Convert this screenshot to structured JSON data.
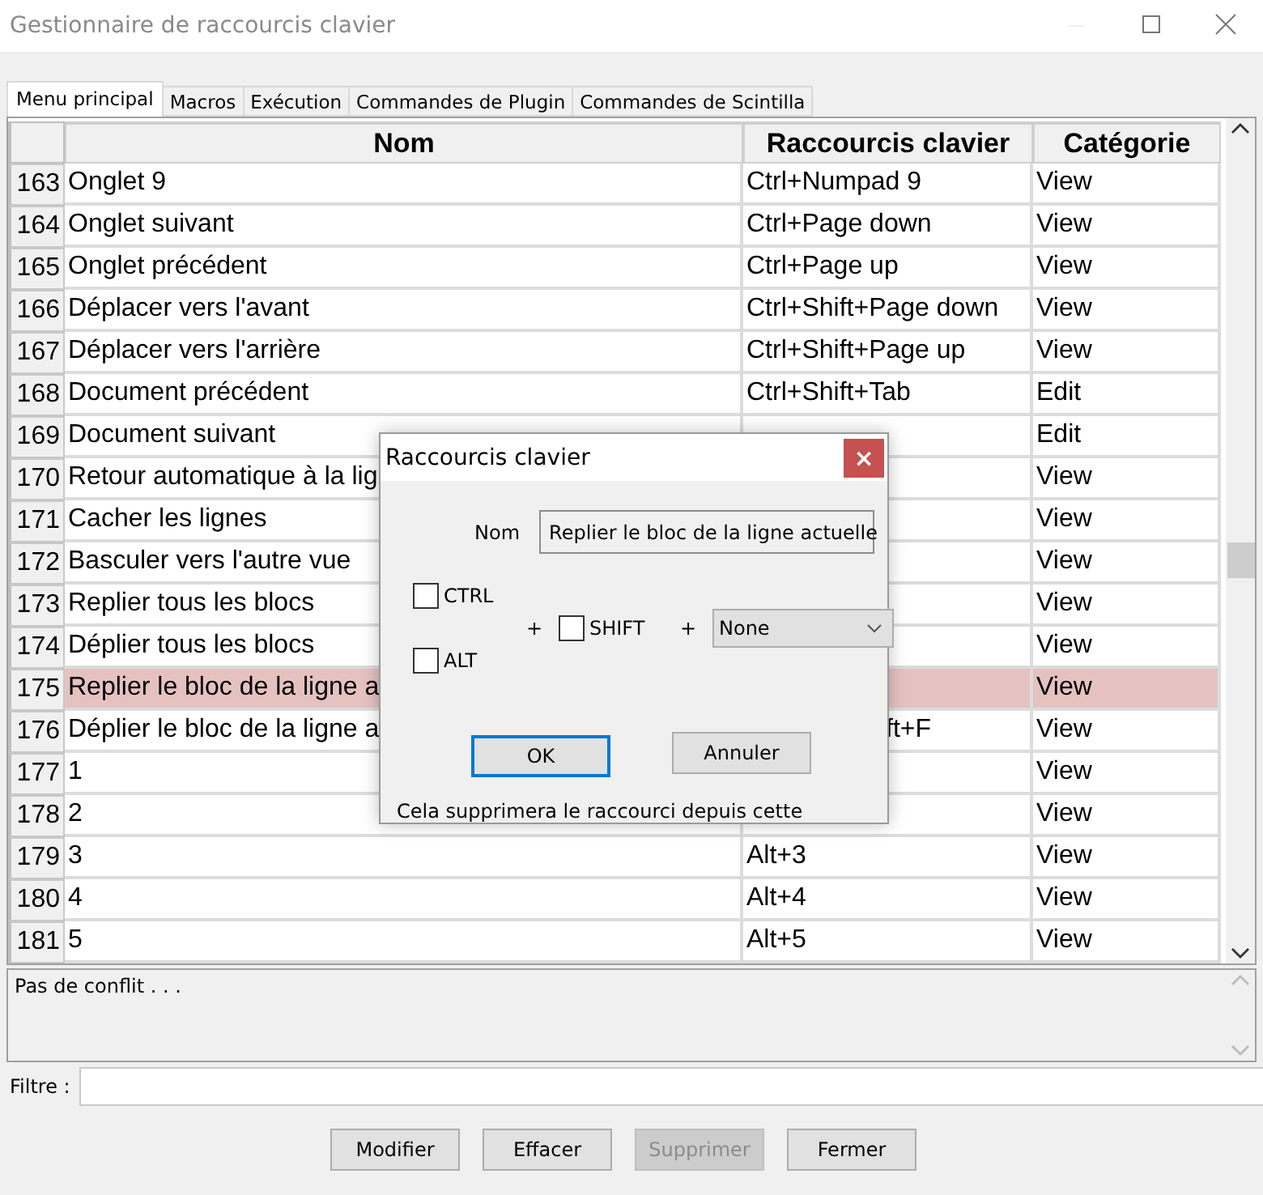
{
  "window": {
    "title": "Gestionnaire de raccourcis clavier"
  },
  "tabs": [
    {
      "label": "Menu principal",
      "selected": true
    },
    {
      "label": "Macros",
      "selected": false
    },
    {
      "label": "Exécution",
      "selected": false
    },
    {
      "label": "Commandes de Plugin",
      "selected": false
    },
    {
      "label": "Commandes de Scintilla",
      "selected": false
    }
  ],
  "table": {
    "columns": [
      "Nom",
      "Raccourcis clavier",
      "Catégorie"
    ],
    "rows": [
      {
        "number": "163",
        "name": "Onglet 9",
        "shortcut": "Ctrl+Numpad 9",
        "category": "View",
        "selected": false
      },
      {
        "number": "164",
        "name": "Onglet suivant",
        "shortcut": "Ctrl+Page down",
        "category": "View",
        "selected": false
      },
      {
        "number": "165",
        "name": "Onglet précédent",
        "shortcut": "Ctrl+Page up",
        "category": "View",
        "selected": false
      },
      {
        "number": "166",
        "name": "Déplacer vers l'avant",
        "shortcut": "Ctrl+Shift+Page down",
        "category": "View",
        "selected": false
      },
      {
        "number": "167",
        "name": "Déplacer vers l'arrière",
        "shortcut": "Ctrl+Shift+Page up",
        "category": "View",
        "selected": false
      },
      {
        "number": "168",
        "name": "Document précédent",
        "shortcut": "Ctrl+Shift+Tab",
        "category": "Edit",
        "selected": false
      },
      {
        "number": "169",
        "name": "Document suivant",
        "category": "Edit",
        "selected": false
      },
      {
        "number": "170",
        "name": "Retour automatique à la lig",
        "category": "View",
        "selected": false
      },
      {
        "number": "171",
        "name": "Cacher les lignes",
        "category": "View",
        "selected": false
      },
      {
        "number": "172",
        "name": "Basculer vers l'autre vue",
        "category": "View",
        "selected": false
      },
      {
        "number": "173",
        "name": "Replier tous les blocs",
        "category": "View",
        "selected": false
      },
      {
        "number": "174",
        "name": "Déplier tous les blocs",
        "category": "View",
        "selected": false
      },
      {
        "number": "175",
        "name": "Replier le bloc de la ligne a",
        "category": "View",
        "selected": true
      },
      {
        "number": "176",
        "name": "Déplier le bloc de la ligne a",
        "shortcut": "ft+F",
        "shortcut_partial": true,
        "category": "View",
        "selected": false
      },
      {
        "number": "177",
        "name": "1",
        "category": "View",
        "selected": false
      },
      {
        "number": "178",
        "name": "2",
        "category": "View",
        "selected": false
      },
      {
        "number": "179",
        "name": "3",
        "shortcut": "Alt+3",
        "category": "View",
        "selected": false
      },
      {
        "number": "180",
        "name": "4",
        "shortcut": "Alt+4",
        "category": "View",
        "selected": false
      },
      {
        "number": "181",
        "name": "5",
        "shortcut": "Alt+5",
        "category": "View",
        "selected": false
      }
    ]
  },
  "conflict": {
    "text": "Pas de conflit . . ."
  },
  "filter": {
    "label": "Filtre :"
  },
  "buttons": [
    {
      "label": "Modifier",
      "disabled": false
    },
    {
      "label": "Effacer",
      "disabled": false
    },
    {
      "label": "Supprimer",
      "disabled": true
    },
    {
      "label": "Fermer",
      "disabled": false
    }
  ],
  "dialog": {
    "title": "Raccourcis clavier",
    "close": "×",
    "name_label": "Nom",
    "name_value": "Replier le bloc de la ligne actuelle",
    "ctrl": {
      "label": "CTRL",
      "checked": false
    },
    "alt": {
      "label": "ALT",
      "checked": false
    },
    "shift": {
      "label": "SHIFT",
      "checked": false
    },
    "plus_1": "+",
    "plus_2": "+",
    "key": "None",
    "buttons": [
      {
        "label": "OK",
        "focused": true
      },
      {
        "label": "Annuler",
        "focused": false
      }
    ],
    "note": "Cela supprimera le raccourci depuis cette"
  }
}
